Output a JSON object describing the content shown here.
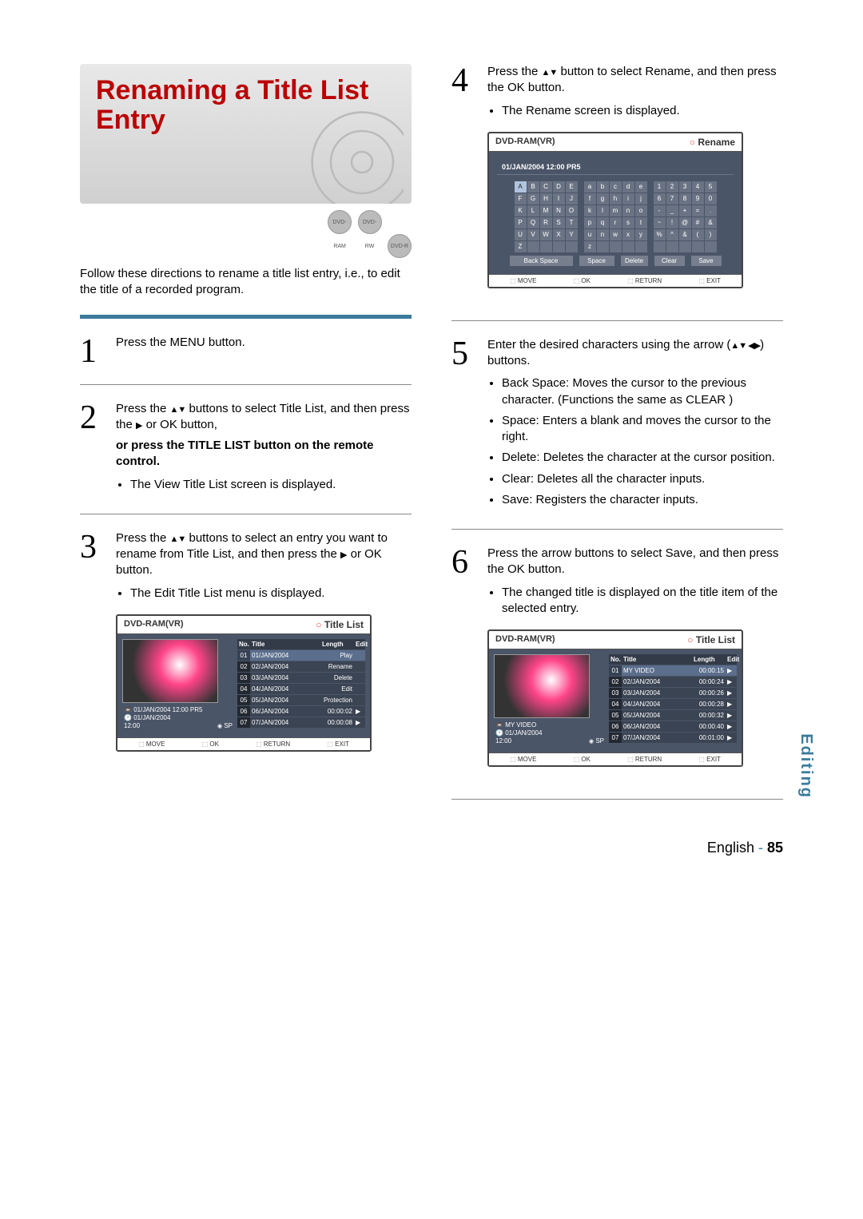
{
  "heading": "Renaming a Title List Entry",
  "disc_icons": [
    "DVD-RAM",
    "DVD-RW",
    "DVD-R"
  ],
  "intro": "Follow these directions to rename a title list entry, i.e., to edit the title of a recorded program.",
  "steps": {
    "s1": {
      "num": "1",
      "text": "Press the MENU button."
    },
    "s2": {
      "num": "2",
      "text_a": "Press the ",
      "text_b": " buttons to select Title List, and then press the ",
      "text_c": " or OK button,",
      "bold": "or press the TITLE LIST button on the remote control.",
      "bullet": "The View Title List screen is displayed."
    },
    "s3": {
      "num": "3",
      "text_a": "Press the ",
      "text_b": " buttons to select an entry you want to rename from Title List, and then press the ",
      "text_c": " or OK button.",
      "bullet": "The Edit Title List menu is displayed."
    },
    "s4": {
      "num": "4",
      "text_a": "Press the ",
      "text_b": " button to select Rename, and then press the OK button.",
      "bullet": "The Rename screen is displayed."
    },
    "s5": {
      "num": "5",
      "text_a": "Enter the desired characters using the arrow (",
      "text_b": ") buttons.",
      "bullets": [
        "Back Space: Moves the cursor to the previous character. (Functions the same as CLEAR )",
        "Space: Enters a blank and moves the cursor to the right.",
        "Delete: Deletes the character at the cursor position.",
        "Clear: Deletes all the character inputs.",
        "Save: Registers the character inputs."
      ]
    },
    "s6": {
      "num": "6",
      "text": "Press the arrow buttons to select Save, and then press the OK button.",
      "bullet": "The changed title is displayed on the title item of the selected entry."
    }
  },
  "shot_titlelist": {
    "device": "DVD-RAM(VR)",
    "title": "Title List",
    "infoA": {
      "line1": "01/JAN/2004 12:00 PR5",
      "line2": "01/JAN/2004",
      "line3": "12:00",
      "mode": "SP"
    },
    "cols": {
      "no": "No.",
      "title": "Title",
      "len": "Length",
      "edit": "Edit"
    },
    "rows": [
      {
        "no": "01",
        "title": "01/JAN/2004",
        "len": "Play"
      },
      {
        "no": "02",
        "title": "02/JAN/2004",
        "len": "Rename"
      },
      {
        "no": "03",
        "title": "03/JAN/2004",
        "len": "Delete"
      },
      {
        "no": "04",
        "title": "04/JAN/2004",
        "len": "Edit"
      },
      {
        "no": "05",
        "title": "05/JAN/2004",
        "len": "Protection"
      },
      {
        "no": "06",
        "title": "06/JAN/2004",
        "len": "00:00:02",
        "ed": "▶"
      },
      {
        "no": "07",
        "title": "07/JAN/2004",
        "len": "00:00:08",
        "ed": "▶"
      }
    ],
    "footer": [
      "MOVE",
      "OK",
      "RETURN",
      "EXIT"
    ]
  },
  "shot_rename": {
    "device": "DVD-RAM(VR)",
    "title": "Rename",
    "sub": "01/JAN/2004 12:00 PR5",
    "upper_rows": [
      [
        "A",
        "B",
        "C",
        "D",
        "E"
      ],
      [
        "F",
        "G",
        "H",
        "I",
        "J"
      ],
      [
        "K",
        "L",
        "M",
        "N",
        "O"
      ],
      [
        "P",
        "Q",
        "R",
        "S",
        "T"
      ],
      [
        "U",
        "V",
        "W",
        "X",
        "Y"
      ],
      [
        "Z",
        "",
        "",
        "",
        ""
      ]
    ],
    "lower_rows": [
      [
        "a",
        "b",
        "c",
        "d",
        "e"
      ],
      [
        "f",
        "g",
        "h",
        "i",
        "j"
      ],
      [
        "k",
        "l",
        "m",
        "n",
        "o"
      ],
      [
        "p",
        "q",
        "r",
        "s",
        "t"
      ],
      [
        "u",
        "n",
        "w",
        "x",
        "y"
      ],
      [
        "z",
        "",
        "",
        "",
        ""
      ]
    ],
    "sym_rows": [
      [
        "1",
        "2",
        "3",
        "4",
        "5"
      ],
      [
        "6",
        "7",
        "8",
        "9",
        "0"
      ],
      [
        "-",
        "_",
        "+",
        "=",
        "."
      ],
      [
        "~",
        "!",
        "@",
        "#",
        "&"
      ],
      [
        "%",
        "^",
        "&",
        "(",
        ")"
      ],
      [
        "",
        "",
        "",
        "",
        ""
      ]
    ],
    "buttons": {
      "back": "Back Space",
      "space": "Space",
      "del": "Delete",
      "clear": "Clear",
      "save": "Save"
    },
    "footer": [
      "MOVE",
      "OK",
      "RETURN",
      "EXIT"
    ]
  },
  "shot_result": {
    "device": "DVD-RAM(VR)",
    "title": "Title List",
    "infoA": {
      "line1": "MY VIDEO",
      "line2": "01/JAN/2004",
      "line3": "12:00",
      "mode": "SP"
    },
    "cols": {
      "no": "No.",
      "title": "Title",
      "len": "Length",
      "edit": "Edit"
    },
    "rows": [
      {
        "no": "01",
        "title": "MY VIDEO",
        "len": "00:00:15",
        "ed": "▶"
      },
      {
        "no": "02",
        "title": "02/JAN/2004",
        "len": "00:00:24",
        "ed": "▶"
      },
      {
        "no": "03",
        "title": "03/JAN/2004",
        "len": "00:00:26",
        "ed": "▶"
      },
      {
        "no": "04",
        "title": "04/JAN/2004",
        "len": "00:00:28",
        "ed": "▶"
      },
      {
        "no": "05",
        "title": "05/JAN/2004",
        "len": "00:00:32",
        "ed": "▶"
      },
      {
        "no": "06",
        "title": "06/JAN/2004",
        "len": "00:00:40",
        "ed": "▶"
      },
      {
        "no": "07",
        "title": "07/JAN/2004",
        "len": "00:01:00",
        "ed": "▶"
      }
    ],
    "footer": [
      "MOVE",
      "OK",
      "RETURN",
      "EXIT"
    ]
  },
  "side_label": "Editing",
  "footer": {
    "lang": "English",
    "dash": " - ",
    "page": "85"
  }
}
